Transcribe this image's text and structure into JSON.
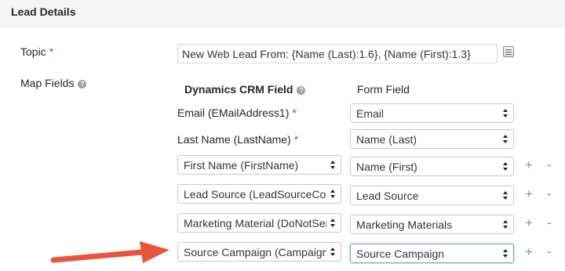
{
  "section": {
    "title": "Lead Details"
  },
  "topic": {
    "label": "Topic",
    "required_mark": "*",
    "value": "New Web Lead From: {Name (Last):1.6}, {Name (First):1.3}"
  },
  "map_fields": {
    "label": "Map Fields",
    "help_glyph": "?",
    "crm_header": "Dynamics CRM Field",
    "form_header": "Form Field",
    "required_rows": [
      {
        "crm_label": "Email (EMailAddress1)",
        "required_mark": "*",
        "form_value": "Email"
      },
      {
        "crm_label": "Last Name (LastName)",
        "required_mark": "*",
        "form_value": "Name (Last)"
      }
    ],
    "custom_rows": [
      {
        "crm_value": "First Name (FirstName)",
        "form_value": "Name (First)"
      },
      {
        "crm_value": "Lead Source (LeadSourceCode)",
        "form_value": "Lead Source"
      },
      {
        "crm_value": "Marketing Material (DoNotSendMM)",
        "form_value": "Marketing Materials"
      },
      {
        "crm_value": "Source Campaign (CampaignId)",
        "form_value": "Source Campaign"
      }
    ],
    "add_glyph": "+",
    "remove_glyph": "-"
  },
  "colors": {
    "required": "#dc3232",
    "annotation_arrow": "#e8553e",
    "focus_border": "#6aa0d8"
  }
}
